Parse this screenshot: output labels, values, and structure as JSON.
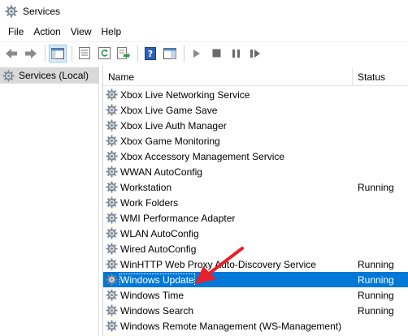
{
  "window": {
    "title": "Services"
  },
  "menu": [
    "File",
    "Action",
    "View",
    "Help"
  ],
  "toolbar": {
    "buttons": [
      "back-icon",
      "forward-icon",
      "console-tree-icon",
      "properties-icon",
      "refresh-icon",
      "export-icon",
      "help-icon",
      "view-icon",
      "play-icon",
      "stop-icon",
      "pause-icon",
      "restart-icon"
    ]
  },
  "tree": {
    "root": "Services (Local)"
  },
  "columns": {
    "name": "Name",
    "status": "Status"
  },
  "services": [
    {
      "name": "Xbox Live Networking Service",
      "status": ""
    },
    {
      "name": "Xbox Live Game Save",
      "status": ""
    },
    {
      "name": "Xbox Live Auth Manager",
      "status": ""
    },
    {
      "name": "Xbox Game Monitoring",
      "status": ""
    },
    {
      "name": "Xbox Accessory Management Service",
      "status": ""
    },
    {
      "name": "WWAN AutoConfig",
      "status": ""
    },
    {
      "name": "Workstation",
      "status": "Running"
    },
    {
      "name": "Work Folders",
      "status": ""
    },
    {
      "name": "WMI Performance Adapter",
      "status": ""
    },
    {
      "name": "WLAN AutoConfig",
      "status": ""
    },
    {
      "name": "Wired AutoConfig",
      "status": ""
    },
    {
      "name": "WinHTTP Web Proxy Auto-Discovery Service",
      "status": "Running"
    },
    {
      "name": "Windows Update",
      "status": "Running",
      "selected": true
    },
    {
      "name": "Windows Time",
      "status": "Running"
    },
    {
      "name": "Windows Search",
      "status": "Running"
    },
    {
      "name": "Windows Remote Management (WS-Management)",
      "status": ""
    }
  ],
  "colors": {
    "selection": "#0078d7",
    "annotation_arrow": "#e8202a"
  }
}
